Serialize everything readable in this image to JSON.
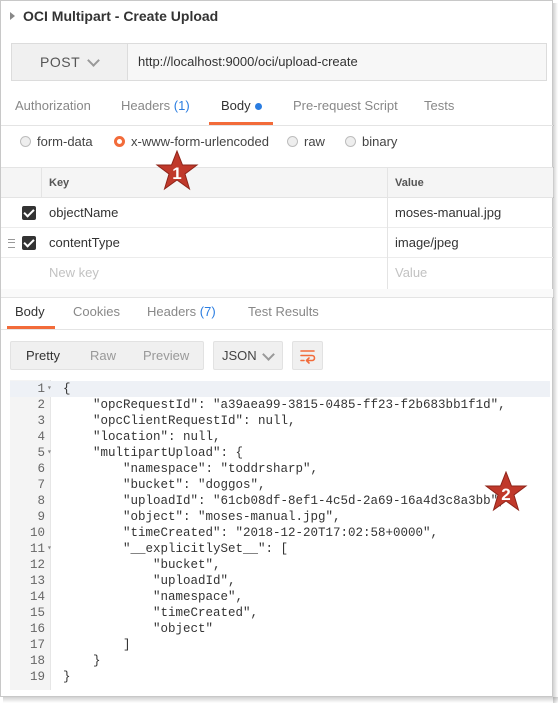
{
  "window": {
    "title": "OCI Multipart - Create Upload"
  },
  "request": {
    "method": "POST",
    "url": "http://localhost:9000/oci/upload-create",
    "tabs": [
      {
        "label": "Authorization"
      },
      {
        "label": "Headers",
        "count": "(1)"
      },
      {
        "label": "Body"
      },
      {
        "label": "Pre-request Script"
      },
      {
        "label": "Tests"
      }
    ],
    "body_modes": [
      "form-data",
      "x-www-form-urlencoded",
      "raw",
      "binary"
    ],
    "selected_body_mode": "x-www-form-urlencoded",
    "params_header": {
      "key": "Key",
      "value": "Value"
    },
    "params": [
      {
        "key": "objectName",
        "value": "moses-manual.jpg"
      },
      {
        "key": "contentType",
        "value": "image/jpeg"
      }
    ],
    "new_key_placeholder": "New key",
    "new_value_placeholder": "Value"
  },
  "response": {
    "tabs": [
      {
        "label": "Body"
      },
      {
        "label": "Cookies"
      },
      {
        "label": "Headers",
        "count": "(7)"
      },
      {
        "label": "Test Results"
      }
    ],
    "view_modes": [
      "Pretty",
      "Raw",
      "Preview"
    ],
    "format": "JSON",
    "lines": [
      {
        "n": "1",
        "fold": true,
        "text": "{"
      },
      {
        "n": "2",
        "text": "    \"opcRequestId\": \"a39aea99-3815-0485-ff23-f2b683bb1f1d\","
      },
      {
        "n": "3",
        "text": "    \"opcClientRequestId\": null,"
      },
      {
        "n": "4",
        "text": "    \"location\": null,"
      },
      {
        "n": "5",
        "fold": true,
        "text": "    \"multipartUpload\": {"
      },
      {
        "n": "6",
        "text": "        \"namespace\": \"toddrsharp\","
      },
      {
        "n": "7",
        "text": "        \"bucket\": \"doggos\","
      },
      {
        "n": "8",
        "text": "        \"uploadId\": \"61cb08df-8ef1-4c5d-2a69-16a4d3c8a3bb\","
      },
      {
        "n": "9",
        "text": "        \"object\": \"moses-manual.jpg\","
      },
      {
        "n": "10",
        "text": "        \"timeCreated\": \"2018-12-20T17:02:58+0000\","
      },
      {
        "n": "11",
        "fold": true,
        "text": "        \"__explicitlySet__\": ["
      },
      {
        "n": "12",
        "text": "            \"bucket\","
      },
      {
        "n": "13",
        "text": "            \"uploadId\","
      },
      {
        "n": "14",
        "text": "            \"namespace\","
      },
      {
        "n": "15",
        "text": "            \"timeCreated\","
      },
      {
        "n": "16",
        "text": "            \"object\""
      },
      {
        "n": "17",
        "text": "        ]"
      },
      {
        "n": "18",
        "text": "    }"
      },
      {
        "n": "19",
        "text": "}"
      }
    ]
  },
  "callouts": [
    {
      "label": "1"
    },
    {
      "label": "2"
    }
  ],
  "colors": {
    "accent": "#f26b3a",
    "link": "#2a7de1",
    "callout": "#c0392b"
  }
}
